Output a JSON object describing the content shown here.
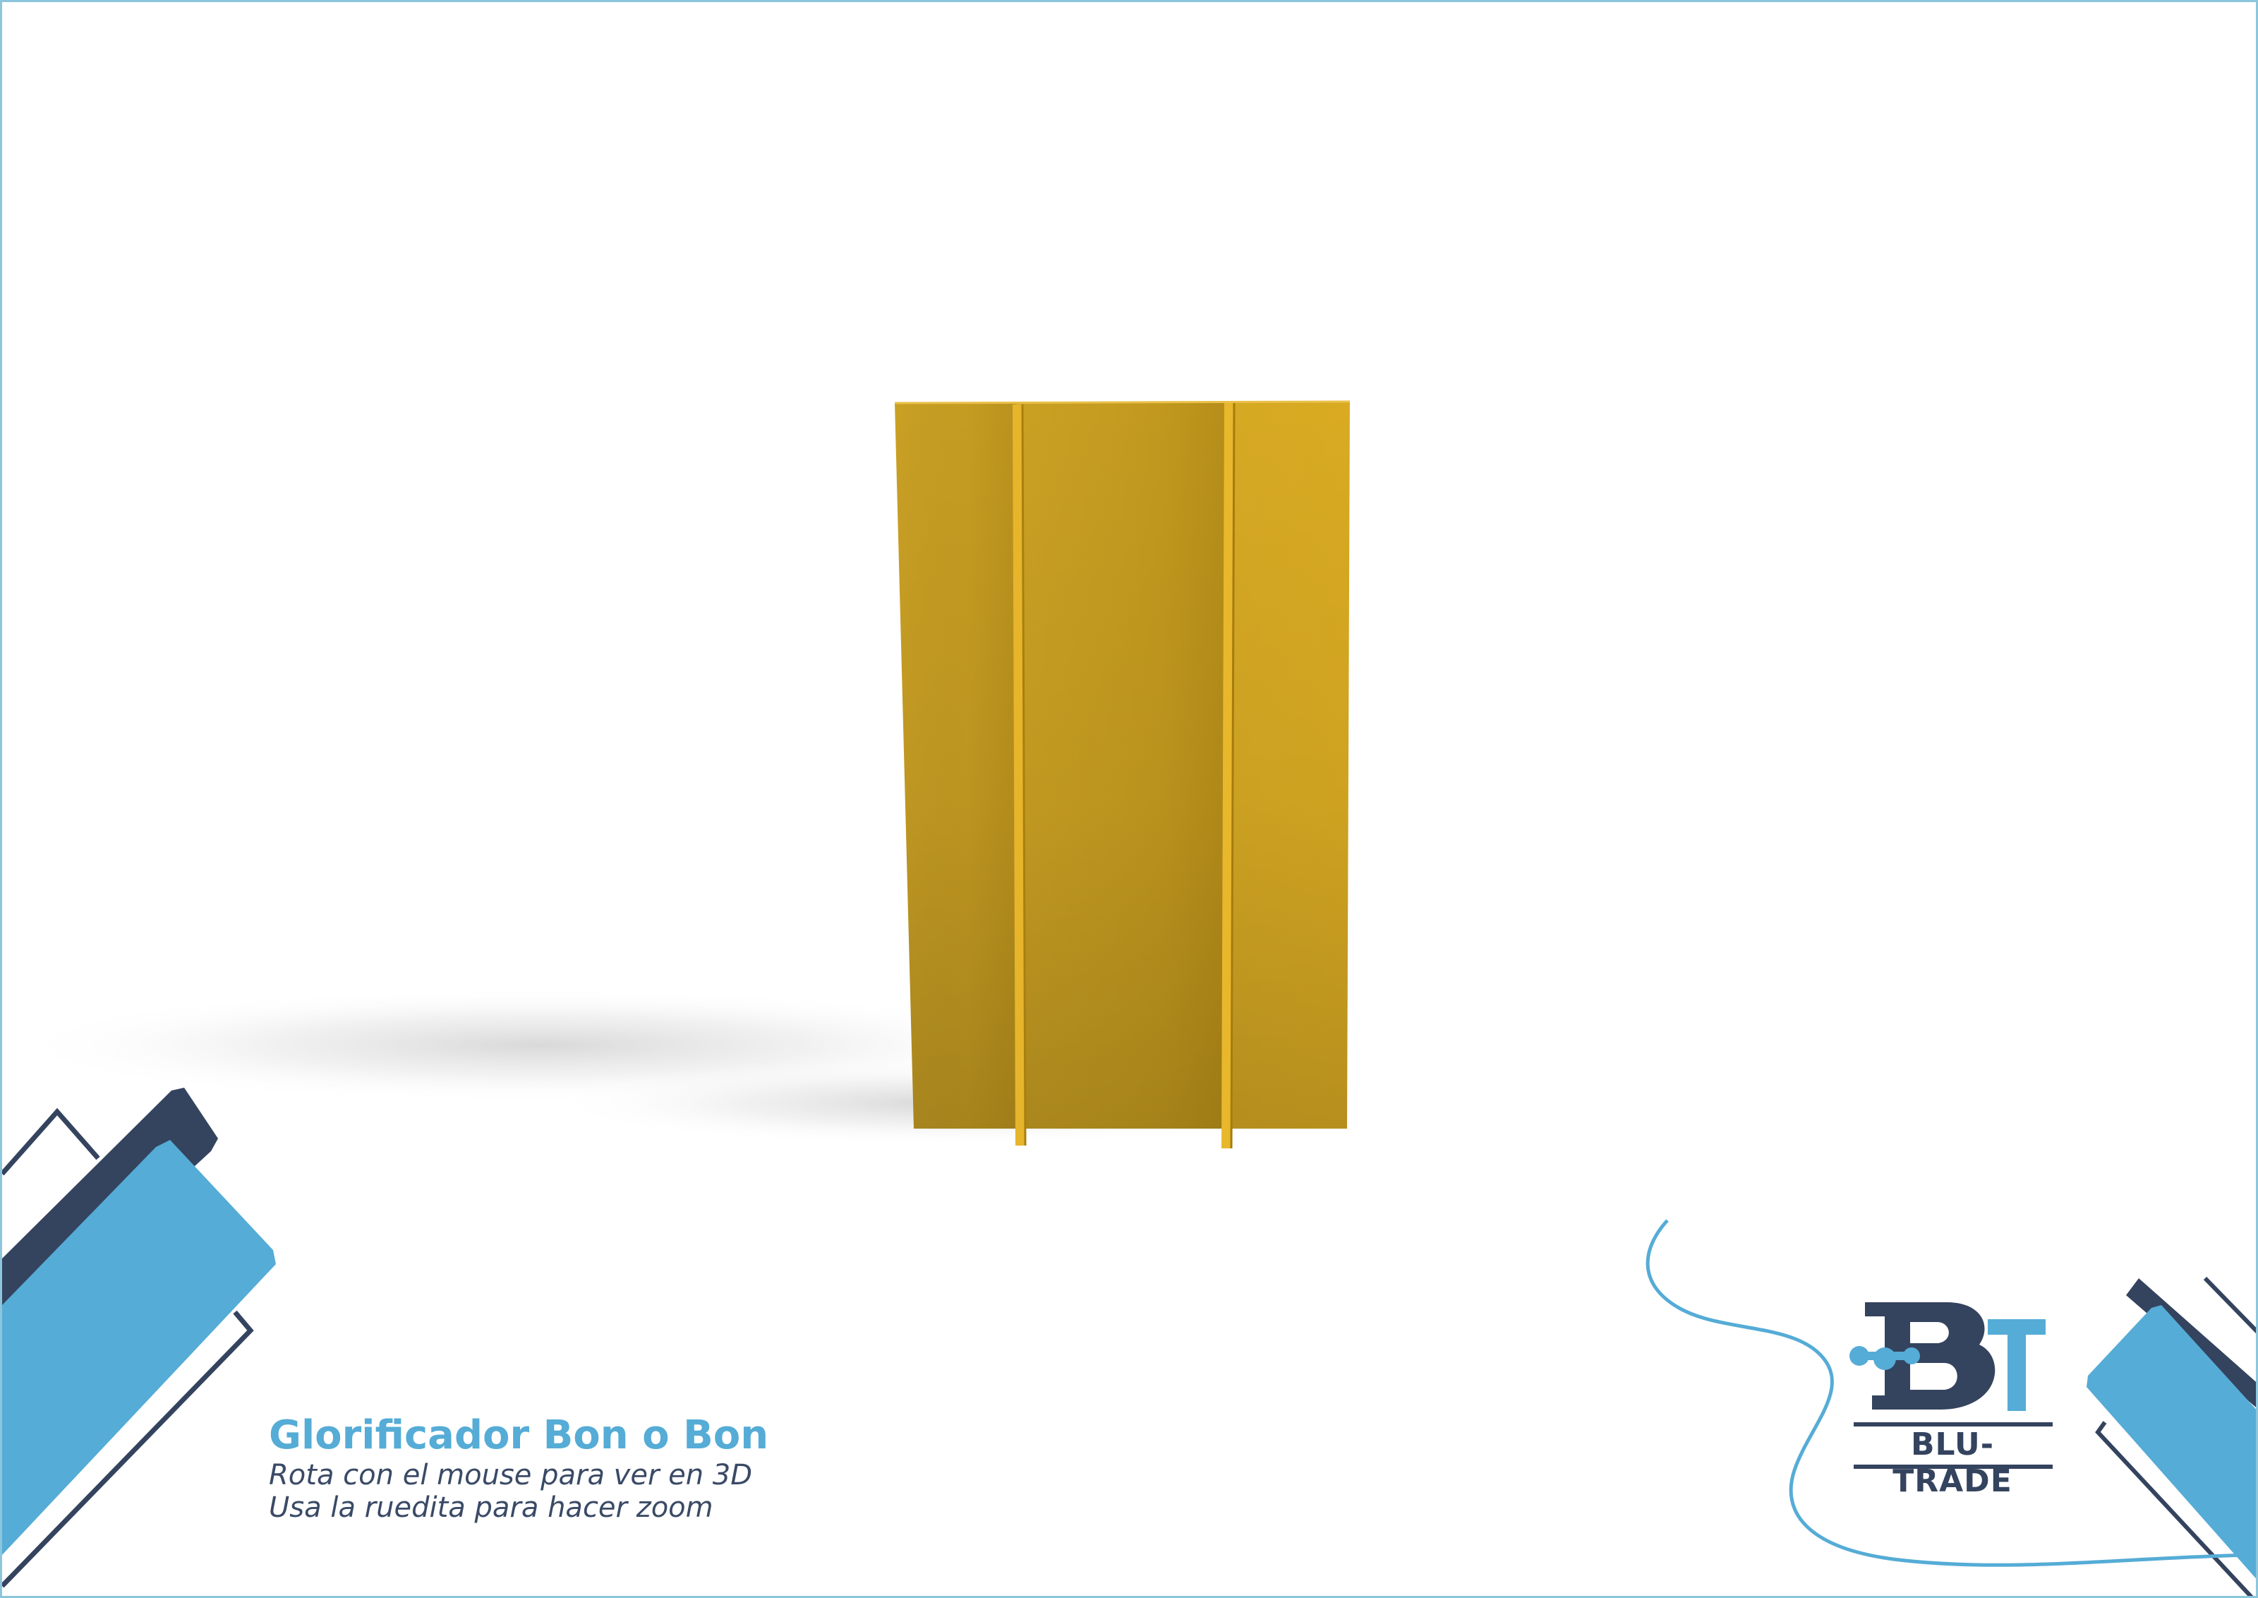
{
  "viewer": {
    "title": "Glorificador Bon o Bon",
    "hint_rotate": "Rota con el mouse para ver en 3D",
    "hint_zoom": "Usa la ruedita para hacer zoom"
  },
  "brand": {
    "name": "BLU-TRADE",
    "monogram": "BT"
  },
  "colors": {
    "accent_blue": "#55acd6",
    "navy": "#34435e",
    "model_yellow": "#d8a922",
    "frame_border": "#8cc6dc",
    "background": "#ffffff"
  },
  "icons": {
    "corner_left": "diagonal-stripes-decoration",
    "corner_right": "diagonal-stripes-decoration",
    "brand_logo": "bt-monogram-logo"
  }
}
